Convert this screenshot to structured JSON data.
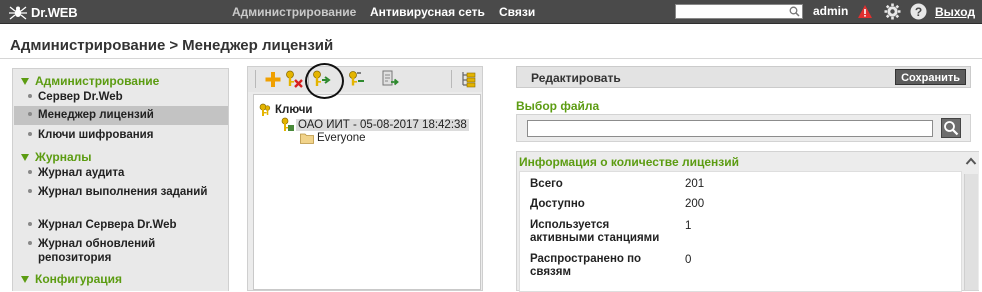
{
  "topbar": {
    "brand": "Dr.WEB",
    "nav": [
      "Администрирование",
      "Антивирусная сеть",
      "Связи"
    ],
    "search_placeholder": "",
    "user": "admin",
    "logout": "Выход",
    "icons": [
      "spider-logo-icon",
      "search-icon",
      "alert-icon",
      "gear-icon",
      "help-icon"
    ]
  },
  "breadcrumb": {
    "parent": "Администрирование",
    "separator": ">",
    "current": "Менеджер лицензий"
  },
  "sidebar": {
    "sections": [
      {
        "title": "Администрирование",
        "items": [
          {
            "label": "Сервер Dr.Web",
            "active": false
          },
          {
            "label": "Менеджер лицензий",
            "active": true
          },
          {
            "label": "Ключи шифрования",
            "active": false
          }
        ]
      },
      {
        "title": "Журналы",
        "items": [
          {
            "label": "Журнал аудита",
            "active": false
          },
          {
            "label": "Журнал выполнения заданий",
            "active": false
          },
          {
            "label": "Журнал Сервера Dr.Web",
            "active": false
          },
          {
            "label": "Журнал обновлений репозитория",
            "active": false
          }
        ]
      },
      {
        "title": "Конфигурация",
        "items": []
      }
    ]
  },
  "license_tree": {
    "toolbar_icons": [
      "add-icon",
      "delete-key-icon",
      "propagate-key-icon",
      "replace-key-icon",
      "export-key-icon",
      "tree-settings-icon"
    ],
    "root": "Ключи",
    "key": "ОАО ИИТ - 05-08-2017 18:42:38",
    "group": "Everyone"
  },
  "editor": {
    "title": "Редактировать",
    "save_label": "Сохранить",
    "file_label": "Выбор файла",
    "file_value": "",
    "info_title": "Информация о количестве лицензий",
    "rows": [
      {
        "label": "Всего",
        "value": "201"
      },
      {
        "label": "Доступно",
        "value": "200"
      },
      {
        "label": "Используется активными станциями",
        "value": "1"
      },
      {
        "label": "Распространено по связям",
        "value": "0"
      }
    ]
  },
  "colors": {
    "topbar": "#4a4a4a",
    "accent_green": "#5c9c12",
    "sidebar_bg": "#e9e9e9",
    "active_item": "#c3c3c3",
    "alert_red": "#e03030",
    "key_yellow": "#e4b400"
  }
}
